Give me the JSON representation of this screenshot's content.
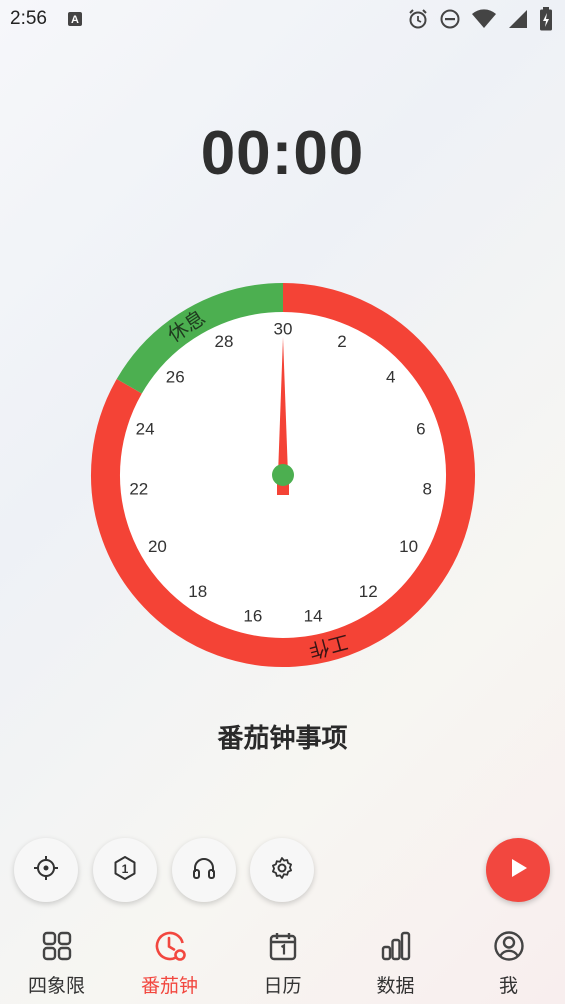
{
  "status_bar": {
    "time": "2:56",
    "left_icons": [
      "text-a-notification-icon"
    ],
    "right_icons": [
      "alarm-icon",
      "do-not-disturb-icon",
      "wifi-icon",
      "cell-signal-icon",
      "battery-icon"
    ]
  },
  "timer": {
    "display": "00:00"
  },
  "dial": {
    "minute_labels": [
      "30",
      "2",
      "4",
      "6",
      "8",
      "10",
      "12",
      "14",
      "16",
      "18",
      "20",
      "22",
      "24",
      "26",
      "28"
    ],
    "work_label": "工作",
    "rest_label": "休息",
    "work_minutes": 25,
    "rest_minutes": 5,
    "total_minutes": 30,
    "hand_minute": 0,
    "colors": {
      "work": "#f44336",
      "rest": "#4caf50",
      "hand": "#f44336",
      "hub": "#4caf50"
    }
  },
  "task": {
    "title": "番茄钟事项"
  },
  "toolbar": {
    "buttons": [
      {
        "name": "focus-target-icon"
      },
      {
        "name": "count-one-icon",
        "text": "1"
      },
      {
        "name": "headphones-icon"
      },
      {
        "name": "gear-icon"
      }
    ],
    "play": {
      "name": "play-icon",
      "color": "#f2473f"
    }
  },
  "bottom_nav": {
    "active_color": "#f2473f",
    "items": [
      {
        "label": "四象限",
        "icon": "grid-quadrant-icon",
        "active": false
      },
      {
        "label": "番茄钟",
        "icon": "pomodoro-clock-icon",
        "active": true
      },
      {
        "label": "日历",
        "icon": "calendar-icon",
        "active": false
      },
      {
        "label": "数据",
        "icon": "bar-chart-icon",
        "active": false
      },
      {
        "label": "我",
        "icon": "user-profile-icon",
        "active": false
      }
    ]
  }
}
